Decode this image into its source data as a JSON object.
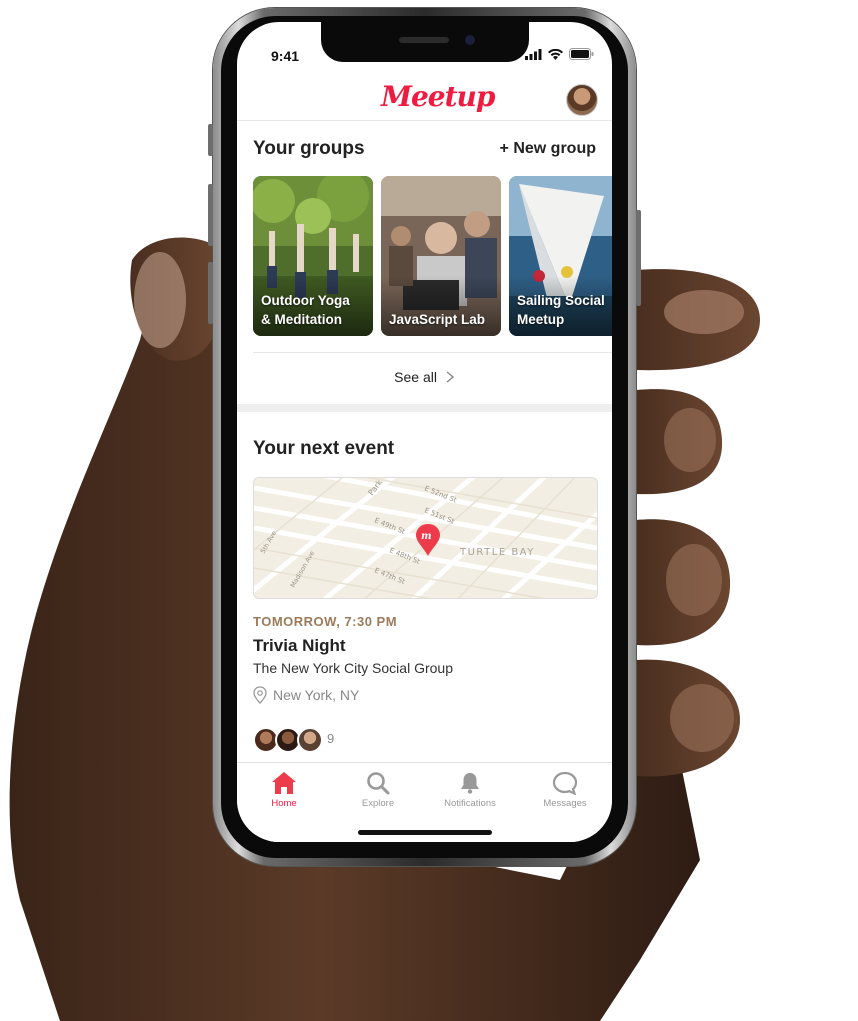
{
  "status_bar": {
    "time": "9:41"
  },
  "header": {
    "logo": "Meetup"
  },
  "groups": {
    "title": "Your groups",
    "new_group": "+ New group",
    "see_all": "See all",
    "items": [
      {
        "name": "Outdoor Yoga & Meditation",
        "line1": "Outdoor Yoga",
        "line2": "& Meditation"
      },
      {
        "name": "JavaScript Lab",
        "line1": "JavaScript Lab",
        "line2": ""
      },
      {
        "name": "Sailing Social Meetup",
        "line1": "Sailing Social",
        "line2": "Meetup"
      }
    ]
  },
  "next_event": {
    "title": "Your next event",
    "map_labels": [
      "Park",
      "E 52nd St",
      "E 51st St",
      "E 49th St",
      "E 48th St",
      "E 47th St",
      "5th Ave",
      "Madison Ave",
      "TURTLE BAY"
    ],
    "date": "TOMORROW, 7:30 PM",
    "name": "Trivia Night",
    "group": "The New York City Social Group",
    "location": "New York, NY",
    "attendee_count": "9"
  },
  "tab_bar": {
    "tabs": [
      {
        "label": "Home",
        "icon": "home-icon",
        "active": true
      },
      {
        "label": "Explore",
        "icon": "search-icon",
        "active": false
      },
      {
        "label": "Notifications",
        "icon": "bell-icon",
        "active": false
      },
      {
        "label": "Messages",
        "icon": "chat-bubble-icon",
        "active": false
      }
    ]
  },
  "colors": {
    "brand": "#ed1c40",
    "date": "#9b7b5a"
  }
}
